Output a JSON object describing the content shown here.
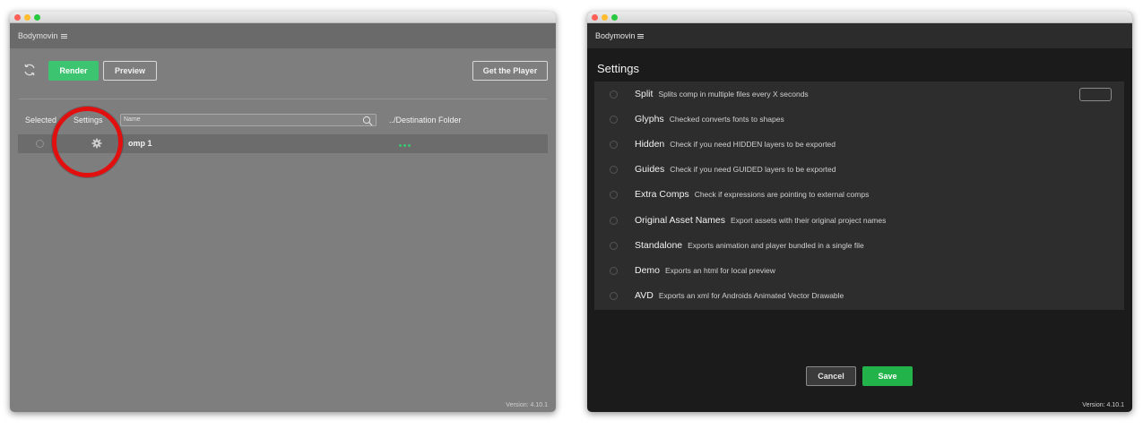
{
  "left_window": {
    "panel_title": "Bodymovin",
    "toolbar": {
      "render_label": "Render",
      "preview_label": "Preview",
      "get_player_label": "Get the Player"
    },
    "columns": {
      "selected": "Selected",
      "settings": "Settings",
      "destination": "../Destination Folder"
    },
    "search": {
      "placeholder": "Name"
    },
    "comp_row": {
      "name": "omp 1"
    },
    "version": "Version: 4.10.1"
  },
  "right_window": {
    "panel_title": "Bodymovin",
    "settings_title": "Settings",
    "options": [
      {
        "name": "Split",
        "description": "Splits comp in multiple files every X seconds"
      },
      {
        "name": "Glyphs",
        "description": "Checked converts fonts to shapes"
      },
      {
        "name": "Hidden",
        "description": "Check if you need HIDDEN layers to be exported"
      },
      {
        "name": "Guides",
        "description": "Check if you need GUIDED layers to be exported"
      },
      {
        "name": "Extra Comps",
        "description": "Check if expressions are pointing to external comps"
      },
      {
        "name": "Original Asset Names",
        "description": "Export assets with their original project names"
      },
      {
        "name": "Standalone",
        "description": "Exports animation and player bundled in a single file"
      },
      {
        "name": "Demo",
        "description": "Exports an html for local preview"
      },
      {
        "name": "AVD",
        "description": "Exports an xml for Androids Animated Vector Drawable"
      }
    ],
    "cancel_label": "Cancel",
    "save_label": "Save",
    "version": "Version: 4.10.1"
  },
  "icons": {
    "refresh": "refresh-icon",
    "gear": "gear-icon",
    "search": "search-icon",
    "menu": "hamburger-menu-icon"
  },
  "colors": {
    "accent_green": "#3cc470",
    "save_green": "#23b34b",
    "highlight_red": "#e20f0f"
  }
}
